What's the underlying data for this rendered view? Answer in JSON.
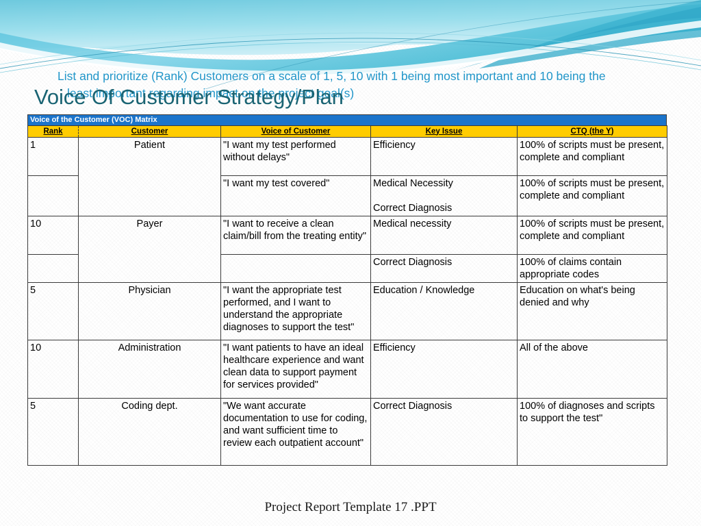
{
  "slide": {
    "subtitle_line1": "List and prioritize (Rank) Customers on a scale of 1, 5, 10 with 1 being most important and 10 being the",
    "subtitle_line2": "least important regarding impact on the project goal(s)",
    "title": "Voice Of Customer Strategy/Plan",
    "footer": "Project Report Template 17 .PPT"
  },
  "colors": {
    "subtitle_text": "#2196c9",
    "title_text": "#1a6473",
    "matrix_bar_bg": "#1b74cb",
    "matrix_bar_text": "#ffffff",
    "header_bg": "#ffcc00",
    "table_border": "#3a3a3a",
    "wave_light": "#bfe8f2",
    "wave_mid": "#7fd3e8",
    "wave_deep": "#35b4cf"
  },
  "matrix": {
    "bar_label": "Voice of the Customer (VOC) Matrix",
    "columns": [
      {
        "key": "rank",
        "label": "Rank"
      },
      {
        "key": "customer",
        "label": "Customer"
      },
      {
        "key": "voice",
        "label": "Voice of Customer"
      },
      {
        "key": "issue",
        "label": "Key Issue"
      },
      {
        "key": "ctq",
        "label": "CTQ (the Y)"
      }
    ],
    "groups": [
      {
        "rank": "1",
        "customer": "Patient",
        "rank_blank": "",
        "rows": [
          {
            "voice": "\"I want my test performed without delays\"",
            "issue": "Efficiency",
            "ctq": "100% of scripts must be present, complete and compliant"
          },
          {
            "voice": "\"I want my test covered\"",
            "issue": "Medical Necessity\n\nCorrect Diagnosis",
            "ctq": "100% of scripts must be present, complete and compliant"
          }
        ]
      },
      {
        "rank": "10",
        "customer": "Payer",
        "rank_blank": "",
        "rows": [
          {
            "voice": "\"I want to receive a clean claim/bill from the treating entity\"",
            "issue": "Medical necessity",
            "ctq": "100% of scripts must be present, complete and compliant"
          },
          {
            "voice": "",
            "issue": "Correct Diagnosis",
            "ctq": "100% of claims contain appropriate codes"
          }
        ]
      },
      {
        "rank": "5",
        "customer": "Physician",
        "rows": [
          {
            "voice": "\"I want the appropriate test performed, and I want to understand the appropriate diagnoses to support the test\"",
            "issue": "Education / Knowledge",
            "ctq": "Education on what's being denied and why"
          }
        ]
      },
      {
        "rank": "10",
        "customer": "Administration",
        "rows": [
          {
            "voice": "\"I want patients to have an ideal healthcare experience and want clean data to support payment for services provided\"",
            "issue": "Efficiency",
            "ctq": "All of the above"
          }
        ]
      },
      {
        "rank": "5",
        "customer": "Coding dept.",
        "rows": [
          {
            "voice": "\"We want accurate documentation to use for coding, and want sufficient time to review each outpatient account\"",
            "issue": "Correct Diagnosis",
            "ctq": "100% of diagnoses and scripts to support the test\""
          }
        ]
      }
    ]
  }
}
